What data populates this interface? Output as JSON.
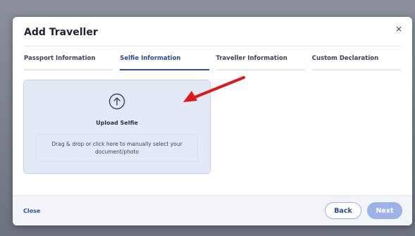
{
  "modal": {
    "title": "Add Traveller",
    "close_symbol": "×"
  },
  "tabs": [
    {
      "label": "Passport Information",
      "active": false
    },
    {
      "label": "Selfie Information",
      "active": true
    },
    {
      "label": "Traveller Information",
      "active": false
    },
    {
      "label": "Custom Declaration",
      "active": false
    }
  ],
  "upload": {
    "icon": "upload-arrow-circle-icon",
    "title": "Upload Selfie",
    "hint": "Drag & drop or click here to manually select your document/photo"
  },
  "footer": {
    "close_label": "Close",
    "back_label": "Back",
    "next_label": "Next"
  },
  "colors": {
    "accent": "#2f4fa8",
    "upload_bg": "#e3e9f7",
    "next_disabled": "#9cb2e8",
    "annotation_arrow": "#e0161b"
  }
}
